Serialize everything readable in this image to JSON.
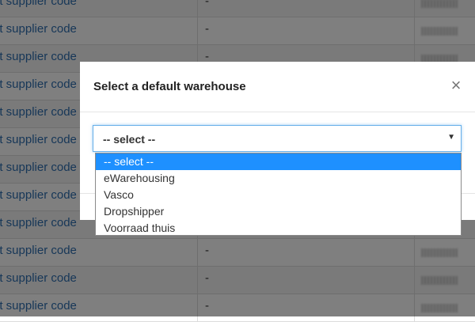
{
  "background": {
    "rows": [
      {
        "link": "et supplier code",
        "dash": "-"
      },
      {
        "link": "et supplier code",
        "dash": "-"
      },
      {
        "link": "et supplier code",
        "dash": "-"
      },
      {
        "link": "et supplier code",
        "dash": "-"
      },
      {
        "link": "et supplier code",
        "dash": "-"
      },
      {
        "link": "et supplier code",
        "dash": "-"
      },
      {
        "link": "et supplier code",
        "dash": "-"
      },
      {
        "link": "et supplier code",
        "dash": "-"
      },
      {
        "link": "et supplier code",
        "dash": "-"
      },
      {
        "link": "et supplier code",
        "dash": "-"
      },
      {
        "link": "et supplier code",
        "dash": "-"
      },
      {
        "link": "et supplier code",
        "dash": "-"
      }
    ]
  },
  "modal": {
    "title": "Select a default warehouse",
    "close_symbol": "×",
    "select": {
      "value": "-- select --",
      "arrow": "▼"
    },
    "options": [
      {
        "label": "-- select --",
        "selected": true
      },
      {
        "label": "eWarehousing",
        "selected": false
      },
      {
        "label": "Vasco",
        "selected": false
      },
      {
        "label": "Dropshipper",
        "selected": false
      },
      {
        "label": "Voorraad thuis",
        "selected": false
      }
    ]
  },
  "colors": {
    "link": "#2f6fb0",
    "highlight": "#1e90ff",
    "focus_border": "#66afe9"
  }
}
